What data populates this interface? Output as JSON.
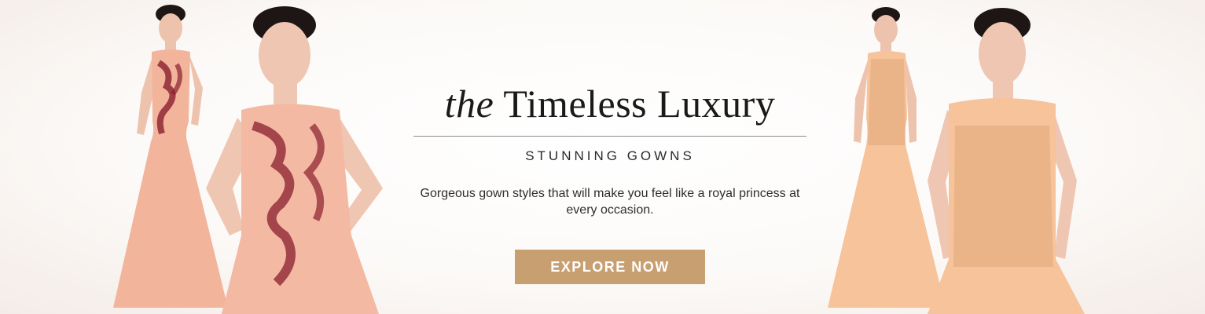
{
  "banner": {
    "headline_prefix": "the",
    "headline_main": "Timeless Luxury",
    "subheading": "STUNNING GOWNS",
    "description": "Gorgeous gown styles that will make you feel like a royal princess at every occasion.",
    "cta_label": "EXPLORE NOW"
  },
  "colors": {
    "cta_background": "#c89f70",
    "gown_peach": "#f2b59c",
    "gown_apricot": "#f6c39a",
    "embroidery_maroon": "#8a1f2e",
    "embroidery_gold": "#e0a77a"
  }
}
